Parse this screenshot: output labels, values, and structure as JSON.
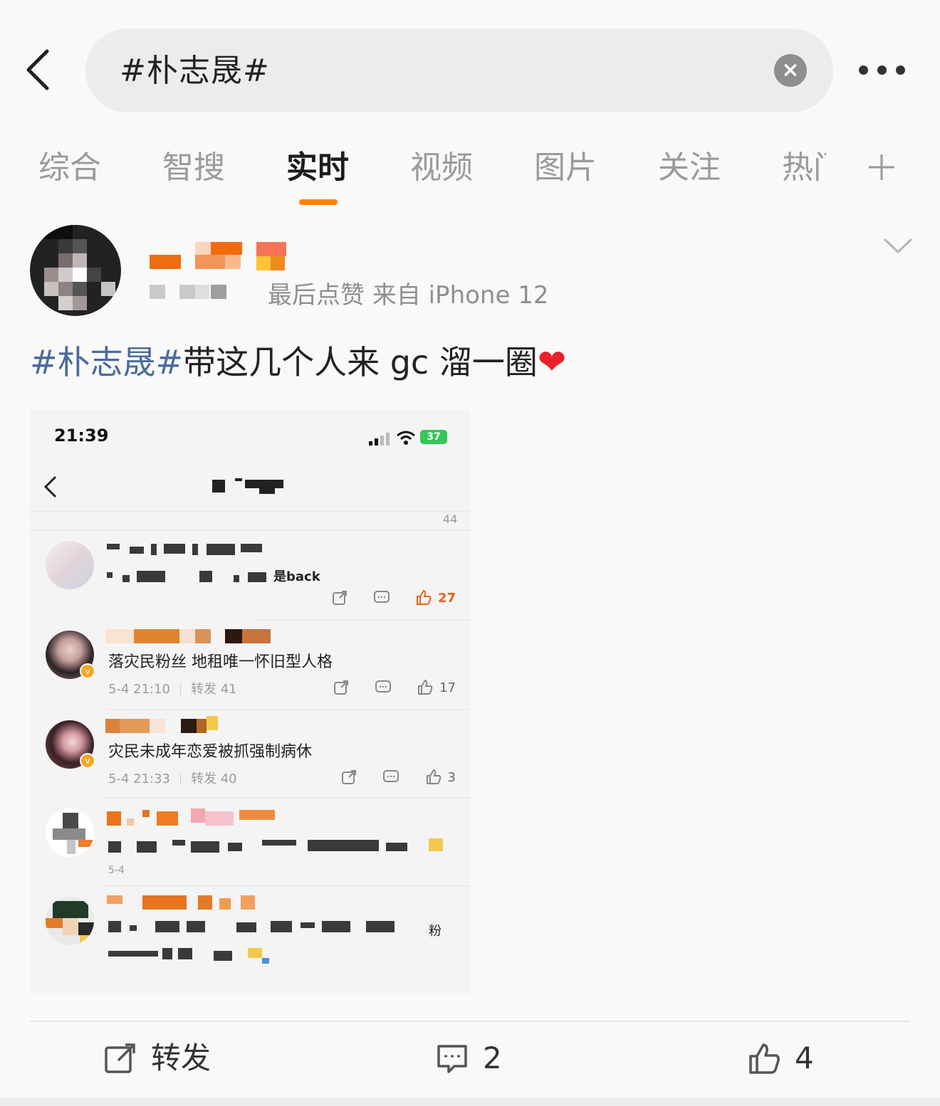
{
  "search": {
    "query": "#朴志晟#"
  },
  "tabs": [
    {
      "label": "综合"
    },
    {
      "label": "智搜"
    },
    {
      "label": "实时"
    },
    {
      "label": "视频"
    },
    {
      "label": "图片"
    },
    {
      "label": "关注"
    },
    {
      "label": "热门"
    }
  ],
  "post": {
    "meta": "最后点赞  来自 iPhone 12",
    "hashtag": "#朴志晟#",
    "body": "带这几个人来 gc 溜一圈",
    "heart": "❤"
  },
  "screenshot": {
    "time": "21:39",
    "battery": "37",
    "top_counts": "44",
    "items": [
      {
        "text_visible": "是back",
        "meta": "",
        "share_count": "",
        "like_count": "27"
      },
      {
        "text": "落灾民粉丝 地租唯一怀旧型人格",
        "date": "5-4 21:10",
        "reposts": "转发 41",
        "like_count": "17"
      },
      {
        "text": "灾民未成年恋爱被抓强制病休",
        "date": "5-4 21:33",
        "reposts": "转发 40",
        "like_count": "3"
      },
      {
        "meta": "5-4"
      },
      {
        "text_visible": "粉"
      }
    ]
  },
  "footer": {
    "repost_label": "转发",
    "comment_count": "2",
    "like_count": "4"
  },
  "colors": {
    "accent": "#ff8200",
    "hashtag": "#4a6c9a",
    "heart": "#e8202a"
  },
  "icons": [
    "back-icon",
    "clear-icon",
    "more-icon",
    "plus-icon",
    "chevron-down-icon",
    "share-icon",
    "comment-icon",
    "like-icon"
  ]
}
